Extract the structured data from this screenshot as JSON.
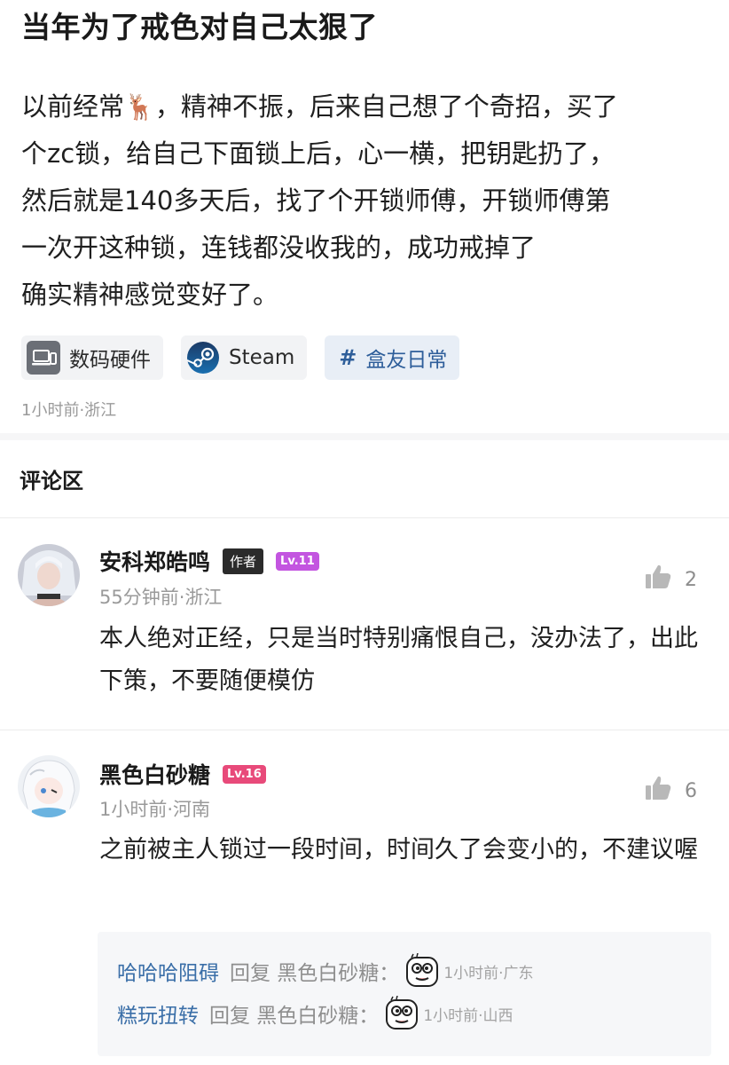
{
  "post": {
    "title": "当年为了戒色对自己太狠了",
    "body_lines": [
      "以前经常",
      "，精神不振，后来自己想了个奇招，买了",
      "个zc锁，给自己下面锁上后，心一横，把钥匙扔了，",
      "然后就是140多天后，找了个开锁师傅，开锁师傅第",
      "一次开这种锁，连钱都没收我的，成功戒掉了",
      "确实精神感觉变好了。"
    ],
    "deer_emoji": "🦌",
    "tags": [
      {
        "label": "数码硬件",
        "icon": "laptop-icon"
      },
      {
        "label": "Steam",
        "icon": "steam-icon"
      },
      {
        "label": "盒友日常",
        "icon": "hash-icon",
        "prefix": "#"
      }
    ],
    "meta": "1小时前·浙江"
  },
  "comments_section": {
    "title": "评论区",
    "comments": [
      {
        "username": "安科郑皓鸣",
        "author_badge": "作者",
        "level": "Lv.11",
        "level_color": "#c355e0",
        "time": "55分钟前·浙江",
        "likes": "2",
        "text": "本人绝对正经，只是当时特别痛恨自己，没办法了，出此下策，不要随便模仿"
      },
      {
        "username": "黑色白砂糖",
        "level": "Lv.16",
        "level_color": "#e84a7a",
        "time": "1小时前·河南",
        "likes": "6",
        "text": "之前被主人锁过一段时间，时间久了会变小的，不建议喔",
        "replies": [
          {
            "user": "哈哈哈阻碍",
            "action": "回复 黑色白砂糖：",
            "time": "1小时前·广东"
          },
          {
            "user": "糕玩扭转",
            "action": "回复 黑色白砂糖：",
            "time": "1小时前·山西"
          }
        ]
      }
    ]
  }
}
